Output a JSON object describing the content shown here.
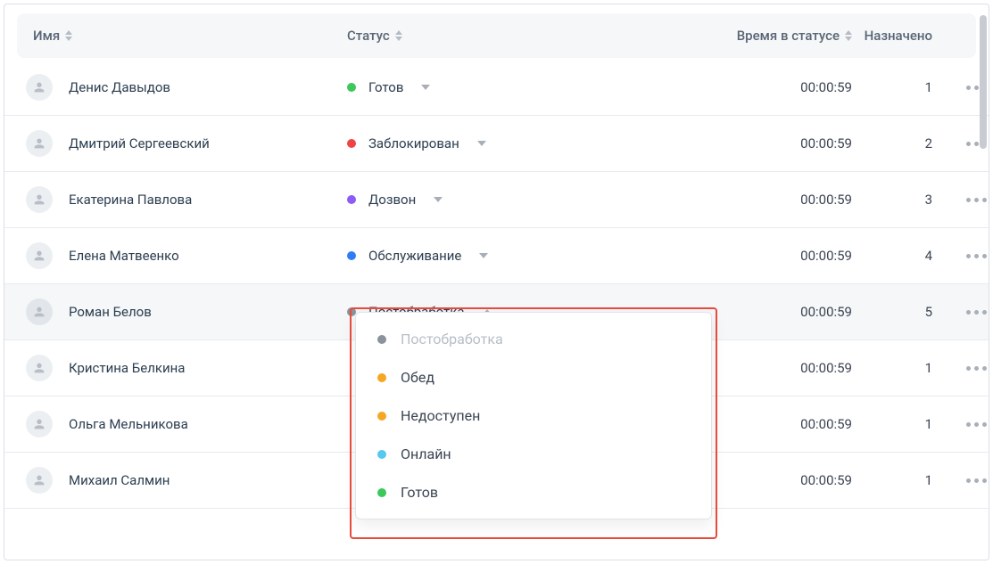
{
  "columns": {
    "name": "Имя",
    "status": "Статус",
    "time_in_status": "Время в статусе",
    "assigned": "Назначено"
  },
  "status_colors": {
    "ready": "#3cc85a",
    "blocked": "#ef4444",
    "dialing": "#8b5cf6",
    "service": "#2f7df6",
    "postprocessing": "#8a929c",
    "lunch": "#f5a623",
    "unavailable": "#f5a623",
    "online": "#59c8f0"
  },
  "rows": [
    {
      "name": "Денис Давыдов",
      "status_key": "ready",
      "status_label": "Готов",
      "time": "00:00:59",
      "assigned": "1",
      "open": false
    },
    {
      "name": "Дмитрий Сергеевский",
      "status_key": "blocked",
      "status_label": "Заблокирован",
      "time": "00:00:59",
      "assigned": "2",
      "open": false
    },
    {
      "name": "Екатерина Павлова",
      "status_key": "dialing",
      "status_label": "Дозвон",
      "time": "00:00:59",
      "assigned": "3",
      "open": false
    },
    {
      "name": "Елена Матвеенко",
      "status_key": "service",
      "status_label": "Обслуживание",
      "time": "00:00:59",
      "assigned": "4",
      "open": false
    },
    {
      "name": "Роман Белов",
      "status_key": "postprocessing",
      "status_label": "Постобработка",
      "time": "00:00:59",
      "assigned": "5",
      "open": true,
      "active": true
    },
    {
      "name": "Кристина Белкина",
      "status_key": "postprocessing",
      "status_label": "",
      "time": "00:00:59",
      "assigned": "1",
      "open": false,
      "hide_status": true
    },
    {
      "name": "Ольга Мельникова",
      "status_key": "postprocessing",
      "status_label": "",
      "time": "00:00:59",
      "assigned": "1",
      "open": false,
      "hide_status": true
    },
    {
      "name": "Михаил Салмин",
      "status_key": "postprocessing",
      "status_label": "",
      "time": "00:00:59",
      "assigned": "1",
      "open": false,
      "hide_status": true
    }
  ],
  "dropdown": [
    {
      "key": "postprocessing",
      "label": "Постобработка",
      "disabled": true
    },
    {
      "key": "lunch",
      "label": "Обед",
      "disabled": false
    },
    {
      "key": "unavailable",
      "label": "Недоступен",
      "disabled": false
    },
    {
      "key": "online",
      "label": "Онлайн",
      "disabled": false
    },
    {
      "key": "ready",
      "label": "Готов",
      "disabled": false
    }
  ]
}
